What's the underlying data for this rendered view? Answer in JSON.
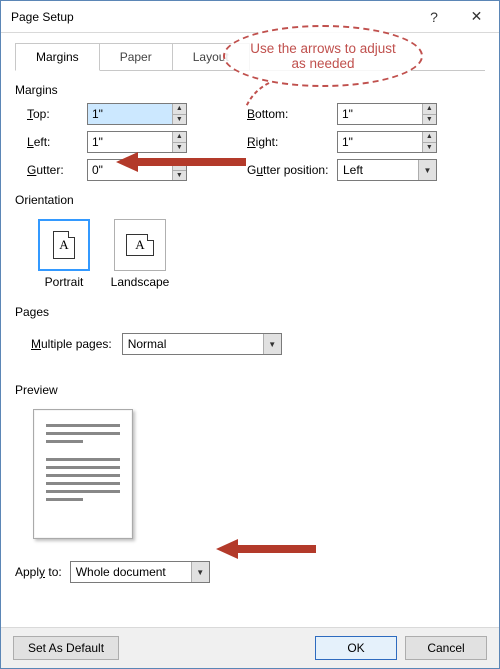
{
  "window": {
    "title": "Page Setup"
  },
  "tabs": {
    "margins": "Margins",
    "paper": "Paper",
    "layout": "Layout"
  },
  "margins_section": {
    "label": "Margins",
    "top_label": "Top:",
    "top_value": "1\"",
    "bottom_label": "Bottom:",
    "bottom_value": "1\"",
    "left_label": "Left:",
    "left_value": "1\"",
    "right_label": "Right:",
    "right_value": "1\"",
    "gutter_label": "Gutter:",
    "gutter_value": "0\"",
    "gutter_pos_label": "Gutter position:",
    "gutter_pos_value": "Left"
  },
  "orientation": {
    "label": "Orientation",
    "portrait": "Portrait",
    "landscape": "Landscape"
  },
  "pages": {
    "label": "Pages",
    "multiple_label": "Multiple pages:",
    "multiple_value": "Normal"
  },
  "preview": {
    "label": "Preview"
  },
  "apply_to": {
    "label": "Apply to:",
    "value": "Whole document"
  },
  "buttons": {
    "set_default": "Set As Default",
    "ok": "OK",
    "cancel": "Cancel"
  },
  "annotation": {
    "callout": "Use the arrows to adjust as needed"
  }
}
